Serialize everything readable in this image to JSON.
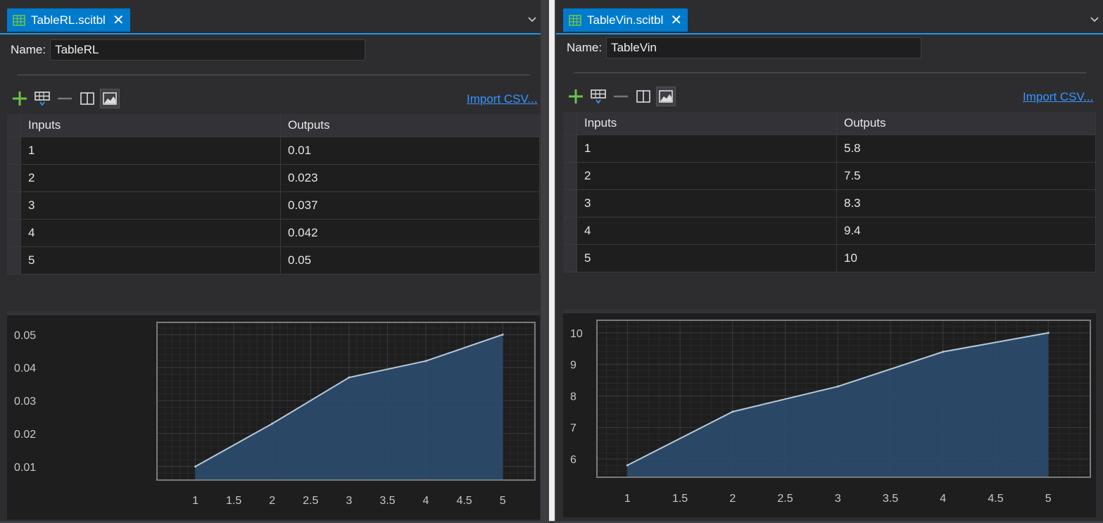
{
  "panels": [
    {
      "tab_title": "TableRL.scitbl",
      "name_label": "Name:",
      "name_value": "TableRL",
      "import_label": "Import CSV...",
      "columns": [
        "Inputs",
        "Outputs"
      ],
      "rows": [
        [
          "1",
          "0.01"
        ],
        [
          "2",
          "0.023"
        ],
        [
          "3",
          "0.037"
        ],
        [
          "4",
          "0.042"
        ],
        [
          "5",
          "0.05"
        ]
      ]
    },
    {
      "tab_title": "TableVin.scitbl",
      "name_label": "Name:",
      "name_value": "TableVin",
      "import_label": "Import CSV...",
      "columns": [
        "Inputs",
        "Outputs"
      ],
      "rows": [
        [
          "1",
          "5.8"
        ],
        [
          "2",
          "7.5"
        ],
        [
          "3",
          "8.3"
        ],
        [
          "4",
          "9.4"
        ],
        [
          "5",
          "10"
        ]
      ]
    }
  ],
  "icons": [
    "table-icon",
    "close-icon",
    "chevron-down-icon",
    "add-icon",
    "insert-row-icon",
    "remove-icon",
    "split-view-icon",
    "chart-view-icon"
  ],
  "colors": {
    "accent": "#007acc",
    "link": "#3794ff",
    "add": "#6cc24a",
    "fill": "#2b4d6e",
    "line": "#b8c9d9"
  },
  "chart_data": [
    {
      "type": "area",
      "x": [
        1,
        2,
        3,
        4,
        5
      ],
      "values": [
        0.01,
        0.023,
        0.037,
        0.042,
        0.05
      ],
      "xticks": [
        "1",
        "1.5",
        "2",
        "2.5",
        "3",
        "3.5",
        "4",
        "4.5",
        "5"
      ],
      "yticks": [
        "0.01",
        "0.02",
        "0.03",
        "0.04",
        "0.05"
      ],
      "xlim": [
        0.5,
        5.42
      ],
      "ylim": [
        0.0059,
        0.0537
      ],
      "grid": true
    },
    {
      "type": "area",
      "x": [
        1,
        2,
        3,
        4,
        5
      ],
      "values": [
        5.8,
        7.5,
        8.3,
        9.4,
        10
      ],
      "xticks": [
        "1",
        "1.5",
        "2",
        "2.5",
        "3",
        "3.5",
        "4",
        "4.5",
        "5"
      ],
      "yticks": [
        "6",
        "7",
        "8",
        "9",
        "10"
      ],
      "xlim": [
        0.71,
        5.4
      ],
      "ylim": [
        5.42,
        10.4
      ],
      "grid": true
    }
  ]
}
